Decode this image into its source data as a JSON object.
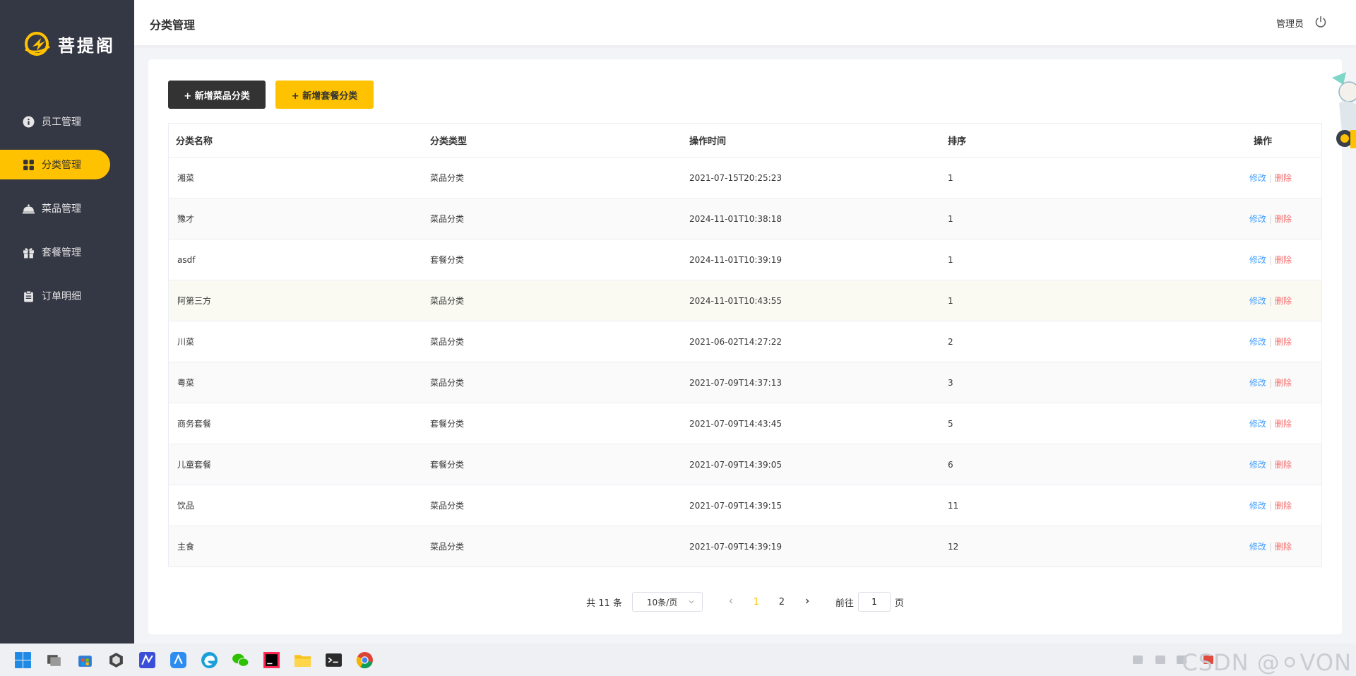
{
  "app": {
    "logo_text": "菩提阁"
  },
  "sidebar": {
    "items": [
      {
        "label": "员工管理",
        "icon": "info-icon"
      },
      {
        "label": "分类管理",
        "icon": "grid-icon",
        "active": true
      },
      {
        "label": "菜品管理",
        "icon": "cloche-icon"
      },
      {
        "label": "套餐管理",
        "icon": "gift-icon"
      },
      {
        "label": "订单明细",
        "icon": "clipboard-icon"
      }
    ]
  },
  "header": {
    "title": "分类管理",
    "user": "管理员",
    "logout_icon": "power-icon"
  },
  "toolbar": {
    "add_dish_category": "+ 新增菜品分类",
    "add_setmeal_category": "+ 新增套餐分类"
  },
  "table": {
    "columns": [
      "分类名称",
      "分类类型",
      "操作时间",
      "排序",
      "操作"
    ],
    "rows": [
      {
        "name": "湘菜",
        "type": "菜品分类",
        "time": "2021-07-15T20:25:23",
        "sort": "1"
      },
      {
        "name": "豫才",
        "type": "菜品分类",
        "time": "2024-11-01T10:38:18",
        "sort": "1"
      },
      {
        "name": "asdf",
        "type": "套餐分类",
        "time": "2024-11-01T10:39:19",
        "sort": "1"
      },
      {
        "name": "阿第三方",
        "type": "菜品分类",
        "time": "2024-11-01T10:43:55",
        "sort": "1"
      },
      {
        "name": "川菜",
        "type": "菜品分类",
        "time": "2021-06-02T14:27:22",
        "sort": "2"
      },
      {
        "name": "粤菜",
        "type": "菜品分类",
        "time": "2021-07-09T14:37:13",
        "sort": "3"
      },
      {
        "name": "商务套餐",
        "type": "套餐分类",
        "time": "2021-07-09T14:43:45",
        "sort": "5"
      },
      {
        "name": "儿童套餐",
        "type": "套餐分类",
        "time": "2021-07-09T14:39:05",
        "sort": "6"
      },
      {
        "name": "饮品",
        "type": "菜品分类",
        "time": "2021-07-09T14:39:15",
        "sort": "11"
      },
      {
        "name": "主食",
        "type": "菜品分类",
        "time": "2021-07-09T14:39:19",
        "sort": "12"
      }
    ],
    "edit_label": "修改",
    "delete_label": "删除"
  },
  "pagination": {
    "total_text": "共 11 条",
    "page_size": "10条/页",
    "pages": [
      "1",
      "2"
    ],
    "current": "1",
    "goto_prefix": "前往",
    "goto_value": "1",
    "goto_suffix": "页"
  },
  "taskbar": {
    "watermark": "CSDN @⚪VON"
  },
  "colors": {
    "sidebar": "#343744",
    "accent": "#ffc200",
    "dark_button": "#333333",
    "link": "#419eff",
    "danger": "#f56c6c"
  }
}
